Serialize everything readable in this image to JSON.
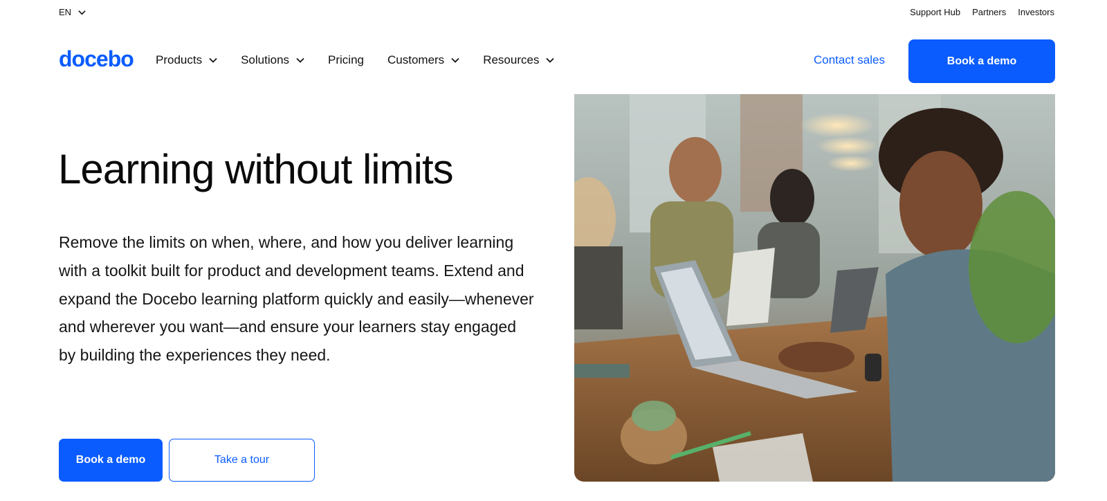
{
  "topbar": {
    "language": "EN",
    "links": [
      "Support Hub",
      "Partners",
      "Investors"
    ]
  },
  "nav": {
    "logo": "docebo",
    "items": [
      {
        "label": "Products",
        "dropdown": true
      },
      {
        "label": "Solutions",
        "dropdown": true
      },
      {
        "label": "Pricing",
        "dropdown": false
      },
      {
        "label": "Customers",
        "dropdown": true
      },
      {
        "label": "Resources",
        "dropdown": true
      }
    ],
    "contact_label": "Contact sales",
    "demo_label": "Book a demo"
  },
  "hero": {
    "title": "Learning without limits",
    "description": "Remove the limits on when, where, and how you deliver learning with a toolkit built for product and development teams. Extend and expand the Docebo learning platform quickly and easily—whenever and wherever you want—and ensure your learners stay engaged by building the experiences they need.",
    "primary_button": "Book a demo",
    "secondary_button": "Take a tour"
  },
  "colors": {
    "brand": "#0a5cff",
    "text": "#111111"
  }
}
